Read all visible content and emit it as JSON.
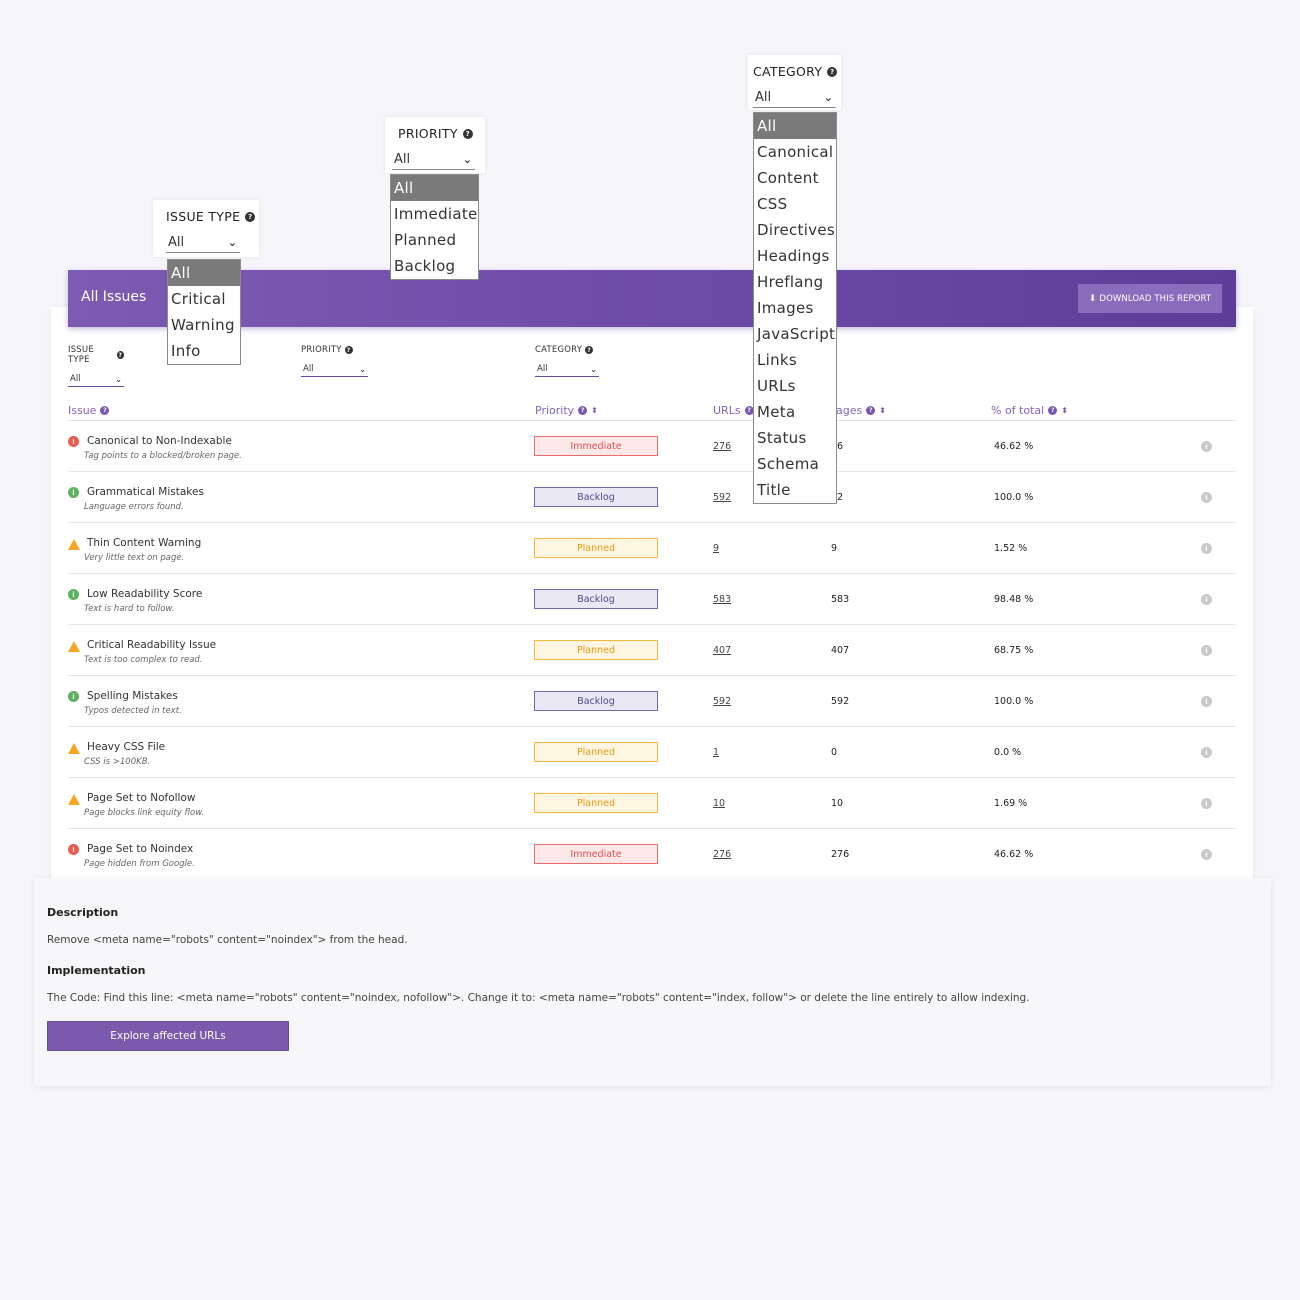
{
  "header": {
    "title": "All Issues",
    "download_label": "DOWNLOAD THIS REPORT",
    "download_icon": "download-icon"
  },
  "filters": {
    "issue_type": {
      "label": "ISSUE TYPE",
      "value": "All"
    },
    "priority": {
      "label": "PRIORITY",
      "value": "All"
    },
    "category": {
      "label": "CATEGORY",
      "value": "All"
    }
  },
  "dropdowns": {
    "issue_type": {
      "label": "ISSUE TYPE",
      "value": "All",
      "options": [
        "All",
        "Critical",
        "Warning",
        "Info"
      ]
    },
    "priority": {
      "label": "PRIORITY",
      "value": "All",
      "options": [
        "All",
        "Immediate",
        "Planned",
        "Backlog"
      ]
    },
    "category": {
      "label": "CATEGORY",
      "value": "All",
      "options": [
        "All",
        "Canonical",
        "Content",
        "CSS",
        "Directives",
        "Headings",
        "Hreflang",
        "Images",
        "JavaScript",
        "Links",
        "URLs",
        "Meta",
        "Status",
        "Schema",
        "Title"
      ]
    }
  },
  "table": {
    "columns": {
      "issue": "Issue",
      "priority": "Priority",
      "urls": "URLs",
      "pages": "ages",
      "pct": "% of total"
    },
    "rows": [
      {
        "type": "critical",
        "name": "Canonical to Non-Indexable",
        "desc": "Tag points to a blocked/broken page.",
        "priority": "Immediate",
        "urls": "276",
        "pages": "76",
        "pct": "46.62 %"
      },
      {
        "type": "info",
        "name": "Grammatical Mistakes",
        "desc": "Language errors found.",
        "priority": "Backlog",
        "urls": "592",
        "pages": "92",
        "pct": "100.0 %"
      },
      {
        "type": "warning",
        "name": "Thin Content Warning",
        "desc": "Very little text on page.",
        "priority": "Planned",
        "urls": "9",
        "pages": "9",
        "pct": "1.52 %"
      },
      {
        "type": "info",
        "name": "Low Readability Score",
        "desc": "Text is hard to follow.",
        "priority": "Backlog",
        "urls": "583",
        "pages": "583",
        "pct": "98.48 %"
      },
      {
        "type": "warning",
        "name": "Critical Readability Issue",
        "desc": "Text is too complex to read.",
        "priority": "Planned",
        "urls": "407",
        "pages": "407",
        "pct": "68.75 %"
      },
      {
        "type": "info",
        "name": "Spelling Mistakes",
        "desc": "Typos detected in text.",
        "priority": "Backlog",
        "urls": "592",
        "pages": "592",
        "pct": "100.0 %"
      },
      {
        "type": "warning",
        "name": "Heavy CSS File",
        "desc": "CSS is >100KB.",
        "priority": "Planned",
        "urls": "1",
        "pages": "0",
        "pct": "0.0 %"
      },
      {
        "type": "warning",
        "name": "Page Set to Nofollow",
        "desc": "Page blocks link equity flow.",
        "priority": "Planned",
        "urls": "10",
        "pages": "10",
        "pct": "1.69 %"
      },
      {
        "type": "critical",
        "name": "Page Set to Noindex",
        "desc": "Page hidden from Google.",
        "priority": "Immediate",
        "urls": "276",
        "pages": "276",
        "pct": "46.62 %"
      }
    ]
  },
  "details": {
    "description_title": "Description",
    "description_text": "Remove <meta name=\"robots\" content=\"noindex\"> from the head.",
    "implementation_title": "Implementation",
    "implementation_text": "The Code: Find this line: <meta name=\"robots\" content=\"noindex, nofollow\">. Change it to: <meta name=\"robots\" content=\"index, follow\"> or delete the line entirely to allow indexing.",
    "explore_label": "Explore affected URLs"
  },
  "colors": {
    "accent": "#6a48a6",
    "critical": "#ef5a4c",
    "info": "#5cb25d",
    "warning": "#f5a623"
  }
}
